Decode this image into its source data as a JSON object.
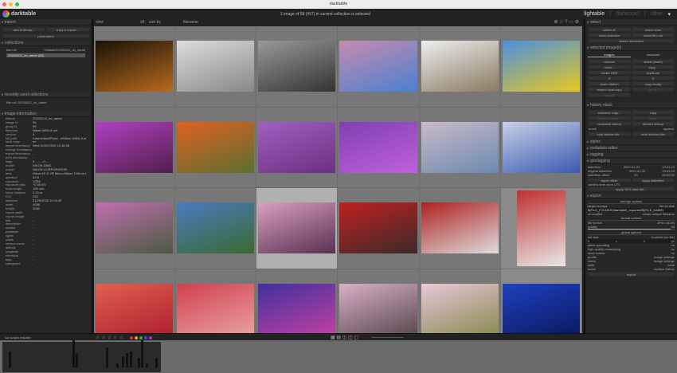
{
  "window": {
    "title": "darktable"
  },
  "header": {
    "app_name": "darktable",
    "status": "1 image of 58 (#57) in current collection is selected",
    "views": [
      "lightable",
      "darkroom",
      "other"
    ]
  },
  "toolbar": {
    "view_label": "view",
    "sort_label": "sort by",
    "sort_value": "filename",
    "zoom": "x8"
  },
  "left": {
    "import": {
      "title": "import",
      "add": "add to library...",
      "copy": "copy & import...",
      "params": "parameters"
    },
    "collections": {
      "title": "collections",
      "rule": "film roll",
      "rule_value": "~/Mobile/20200202_no_name",
      "item": "20200202_no_name (58)"
    },
    "recent": {
      "title": "recently used collections",
      "item": "film roll 20200202_no_name"
    },
    "info": {
      "title": "image information",
      "rows": [
        [
          "filmroll",
          "20200202_no_name"
        ],
        [
          "image id",
          "96"
        ],
        [
          "group id",
          "96"
        ],
        [
          "filename",
          "Nikon D800-8.nef"
        ],
        [
          "version",
          "0"
        ],
        [
          "full path",
          "/Users/dsrd/Pictur...e/Nikon D800-8.nef"
        ],
        [
          "local copy",
          "no"
        ],
        [
          "import timestamp",
          "Wed 02/02/2020 12:18:38"
        ],
        [
          "change timestamp",
          "-"
        ],
        [
          "export timestamp",
          "-"
        ],
        [
          "print timestamp",
          "-"
        ],
        [
          "flags",
          "0..........0...."
        ],
        [
          "model",
          "NIKON D800"
        ],
        [
          "maker",
          "NIKON CORPORATION"
        ],
        [
          "lens",
          "Nikon AF-S VR Micro-Nikkor 105mm f/..."
        ],
        [
          "aperture",
          "f/2.8"
        ],
        [
          "exposure",
          "1/350"
        ],
        [
          "exposure bias",
          "+0.00 EV"
        ],
        [
          "focal length",
          "105 mm"
        ],
        [
          "focus distance",
          "0.78 m"
        ],
        [
          "ISO",
          "200"
        ],
        [
          "datetime",
          "01/29/2020 11:04:45"
        ],
        [
          "width",
          "4936"
        ],
        [
          "height",
          "3280"
        ],
        [
          "export width",
          "-"
        ],
        [
          "export height",
          "-"
        ],
        [
          "title",
          "-"
        ],
        [
          "description",
          "-"
        ],
        [
          "creator",
          "-"
        ],
        [
          "publisher",
          "-"
        ],
        [
          "rights",
          "-"
        ],
        [
          "notes",
          "-"
        ],
        [
          "version name",
          "-"
        ],
        [
          "latitude",
          "-"
        ],
        [
          "longitude",
          "-"
        ],
        [
          "elevation",
          "-"
        ],
        [
          "tags",
          "-"
        ],
        [
          "categories",
          "-"
        ]
      ]
    }
  },
  "right": {
    "select": {
      "title": "select",
      "buttons": [
        "select all",
        "select none",
        "invert selection",
        "select film roll",
        "select untouched"
      ]
    },
    "selected": {
      "title": "selected image[s]",
      "tabs": [
        "images",
        "metadata"
      ],
      "buttons": [
        "remove",
        "delete (trash)",
        "move...",
        "copy...",
        "create HDR",
        "duplicate",
        "↺",
        "↻",
        "reset rotation",
        "copy locally",
        "resync local copy",
        "group",
        "ungroup"
      ]
    },
    "history": {
      "title": "history stack",
      "buttons": [
        "selective copy...",
        "copy",
        "selective paste...",
        "paste",
        "compress history",
        "discard history"
      ],
      "mode_label": "mode",
      "mode_value": "append",
      "load": "load sidecar file...",
      "write": "write sidecar files"
    },
    "collapsed": [
      "styles",
      "metadata editor",
      "tagging"
    ],
    "geotag": {
      "title": "geotagging",
      "rows": [
        [
          "date/time",
          "2020-01-29",
          "13:41:23"
        ],
        [
          "original date/time",
          "2020-01-29",
          "13:41:23"
        ],
        [
          "date/time offset",
          "00",
          "00:00:00"
        ]
      ],
      "apply_offset": "apply offset",
      "apply_datetime": "apply date/time",
      "tz_label": "camera time zone",
      "tz_value": "UTC",
      "gpx": "apply GPX track file..."
    },
    "export": {
      "title": "export",
      "storage_hdr": "storage options",
      "target_label": "target storage",
      "target_value": "file on disk",
      "path": "$(FILE_FOLDER)/darktable_exported/$(FILE_NAME)",
      "conflict_label": "on conflict",
      "conflict_value": "create unique filename",
      "format_hdr": "format options",
      "format_label": "file format",
      "format_value": "JPEG (8-bit)",
      "quality_label": "quality",
      "quality_value": "95",
      "quality_fraction": 0.95,
      "global_hdr": "global options",
      "size_label": "set size",
      "size_value": "in pixels (for file)",
      "w": "0",
      "x": "x",
      "h": "0",
      "px": "px",
      "rows": [
        [
          "allow upscaling",
          "no"
        ],
        [
          "high quality resampling",
          "no"
        ],
        [
          "store masks",
          "no"
        ],
        [
          "profile",
          "image settings"
        ],
        [
          "intent",
          "image settings"
        ],
        [
          "style",
          "none"
        ],
        [
          "mode",
          "replace history"
        ]
      ],
      "button": "export"
    }
  },
  "bottom": {
    "module": "lua scripts installer",
    "stars": [
      "☆",
      "☆",
      "☆",
      "☆",
      "☆"
    ],
    "labels": [
      "#e33030",
      "#e0a020",
      "#30b030",
      "#3050e0",
      "#c030c0"
    ]
  },
  "thumbnails": [
    [
      "#1a1208",
      "#b86a1c"
    ],
    [
      "#ddd",
      "#888"
    ],
    [
      "#999",
      "#333"
    ],
    [
      "#c58cb0",
      "#4a80d0"
    ],
    [
      "#eee",
      "#8a7a60"
    ],
    [
      "#4a90e0",
      "#e8c820"
    ],
    [
      "#b040c0",
      "#50204a"
    ],
    [
      "#e06020",
      "#5a7030"
    ],
    [
      "#a060c0",
      "#6a3080"
    ],
    [
      "#8040b0",
      "#c060e0"
    ],
    [
      "#cbbac8",
      "#6a8ab0"
    ],
    [
      "#c8d0e8",
      "#3a5ab0"
    ],
    [
      "#c070b0",
      "#4a5a40"
    ],
    [
      "#4a7ac0",
      "#3a6a30"
    ],
    [
      "#d8a0c0",
      "#5a3050"
    ],
    [
      "#c02020",
      "#3a2a2a"
    ],
    [
      "#b02020",
      "#ddd"
    ],
    [
      "#c03030",
      "#e8e8e8"
    ],
    [
      "#e06050",
      "#b02030"
    ],
    [
      "#d04050",
      "#e8a0a0"
    ],
    [
      "#4030a0",
      "#c040a0"
    ],
    [
      "#d8b0c8",
      "#5a4a50"
    ],
    [
      "#e8c8d8",
      "#8a8a50"
    ],
    [
      "#2040c0",
      "#0a1a60"
    ]
  ]
}
